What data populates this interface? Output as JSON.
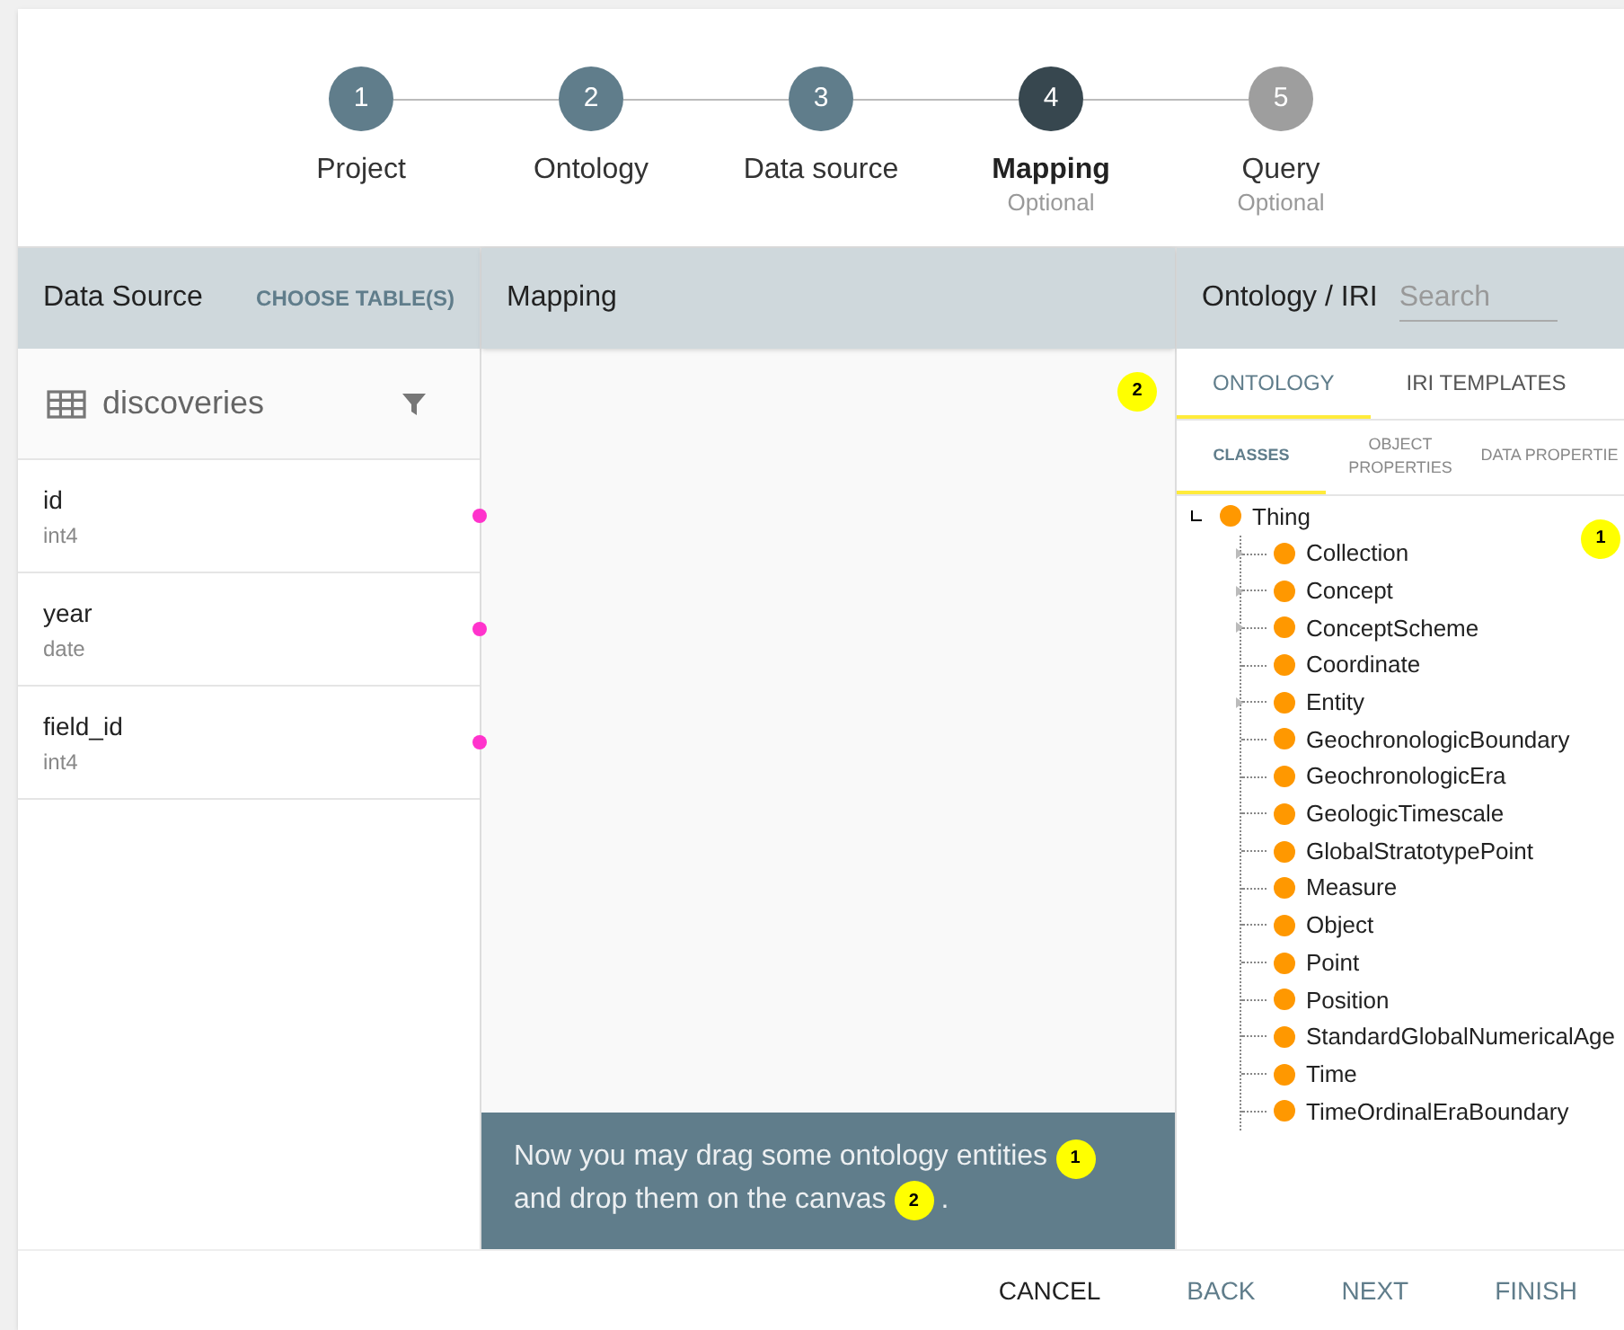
{
  "steps": [
    {
      "number": "1",
      "label": "Project",
      "completed": true,
      "selected": false
    },
    {
      "number": "2",
      "label": "Ontology",
      "completed": true,
      "selected": false
    },
    {
      "number": "3",
      "label": "Data source",
      "completed": true,
      "selected": false
    },
    {
      "number": "4",
      "label": "Mapping",
      "sublabel": "Optional",
      "completed": false,
      "selected": true
    },
    {
      "number": "5",
      "label": "Query",
      "sublabel": "Optional",
      "completed": false,
      "selected": false
    }
  ],
  "data_source": {
    "title": "Data Source",
    "action": "CHOOSE TABLE(S)",
    "table": "discoveries",
    "columns": [
      {
        "name": "id",
        "type": "int4"
      },
      {
        "name": "year",
        "type": "date"
      },
      {
        "name": "field_id",
        "type": "int4"
      }
    ]
  },
  "mapping": {
    "title": "Mapping",
    "badge": "2",
    "hint": [
      {
        "kind": "text",
        "text": "Now you may drag some ontology entities"
      },
      {
        "kind": "badge",
        "text": "1"
      },
      {
        "kind": "text",
        "text": "and drop them on the canvas"
      },
      {
        "kind": "badge",
        "text": "2"
      },
      {
        "kind": "text",
        "text": "."
      }
    ]
  },
  "ontology": {
    "title": "Ontology / IRI",
    "search": {
      "placeholder": "Search"
    },
    "tabs": [
      {
        "label": "ONTOLOGY",
        "selected": true
      },
      {
        "label": "IRI TEMPLATES",
        "selected": false
      }
    ],
    "subtabs": [
      {
        "label": "CLASSES",
        "selected": true
      },
      {
        "label": "OBJECT PROPERTIES",
        "selected": false
      },
      {
        "label": "DATA PROPERTIE",
        "selected": false
      }
    ],
    "badge": "1",
    "tree": [
      {
        "label": "Thing",
        "expanded": true,
        "children": [
          {
            "label": "Collection",
            "expandable": true
          },
          {
            "label": "Concept",
            "expandable": true
          },
          {
            "label": "ConceptScheme",
            "expandable": true
          },
          {
            "label": "Coordinate",
            "expandable": false
          },
          {
            "label": "Entity",
            "expandable": true
          },
          {
            "label": "GeochronologicBoundary",
            "expandable": false
          },
          {
            "label": "GeochronologicEra",
            "expandable": false
          },
          {
            "label": "GeologicTimescale",
            "expandable": false
          },
          {
            "label": "GlobalStratotypePoint",
            "expandable": false
          },
          {
            "label": "Measure",
            "expandable": false
          },
          {
            "label": "Object",
            "expandable": false
          },
          {
            "label": "Point",
            "expandable": false
          },
          {
            "label": "Position",
            "expandable": false
          },
          {
            "label": "StandardGlobalNumericalAge",
            "expandable": false
          },
          {
            "label": "Time",
            "expandable": false
          },
          {
            "label": "TimeOrdinalEraBoundary",
            "expandable": false
          }
        ]
      }
    ]
  },
  "footer": {
    "buttons": [
      {
        "label": "CANCEL",
        "kind": "primary"
      },
      {
        "label": "BACK",
        "kind": "secondary"
      },
      {
        "label": "NEXT",
        "kind": "secondary"
      },
      {
        "label": "FINISH",
        "kind": "secondary"
      }
    ]
  }
}
